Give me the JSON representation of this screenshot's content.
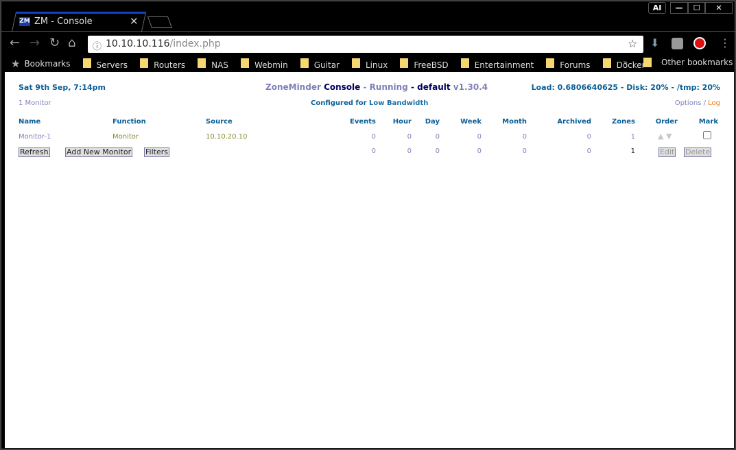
{
  "browser": {
    "tab_title": "ZM - Console",
    "url_host": "10.10.10.116",
    "url_path": "/index.php",
    "profile": "AI",
    "bookmarks": [
      "Servers",
      "Routers",
      "NAS",
      "Webmin",
      "Guitar",
      "Linux",
      "FreeBSD",
      "Entertainment",
      "Forums",
      "Docker"
    ],
    "bookmarks_label": "Bookmarks",
    "other_bookmarks": "Other bookmarks",
    "overflow": "»"
  },
  "header": {
    "datetime": "Sat 9th Sep, 7:14pm",
    "app": "ZoneMinder",
    "console": "Console",
    "sep1": "-",
    "state": "Running",
    "sep2": "-",
    "run_state": "default",
    "version": "v1.30.4",
    "load": "Load: 0.6806640625 - Disk: 20% - /tmp: 20%"
  },
  "subheader": {
    "monitor_count": "1 Monitor",
    "configured_for": "Configured for",
    "bandwidth": "Low Bandwidth",
    "options": "Options",
    "slash": "/",
    "log": "Log"
  },
  "table": {
    "headers": [
      "Name",
      "Function",
      "Source",
      "Events",
      "Hour",
      "Day",
      "Week",
      "Month",
      "Archived",
      "Zones",
      "Order",
      "Mark"
    ],
    "rows": [
      {
        "name": "Monitor-1",
        "function": "Monitor",
        "source": "10.10.20.10",
        "events": "0",
        "hour": "0",
        "day": "0",
        "week": "0",
        "month": "0",
        "archived": "0",
        "zones": "1"
      }
    ],
    "totals": {
      "events": "0",
      "hour": "0",
      "day": "0",
      "week": "0",
      "month": "0",
      "archived": "0",
      "zones": "1"
    }
  },
  "buttons": {
    "refresh": "Refresh",
    "add": "Add New Monitor",
    "filters": "Filters",
    "edit": "Edit",
    "delete": "Delete"
  }
}
